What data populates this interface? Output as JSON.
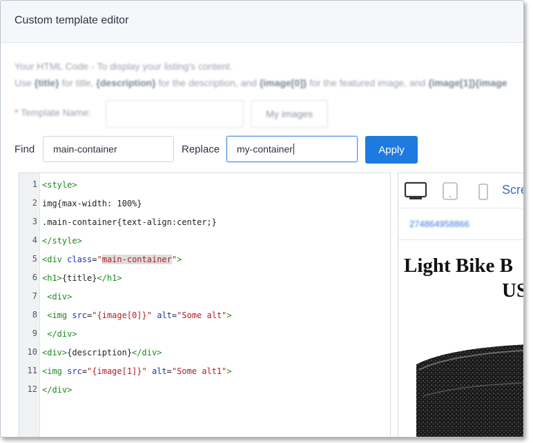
{
  "header": {
    "title": "Custom template editor"
  },
  "help": {
    "line1": "Your HTML Code - To display your listing's content.",
    "line2_parts": [
      "Use ",
      "{title}",
      " for title, ",
      "{description}",
      " for the description, and ",
      "{image[0]}",
      " for the featured image, and ",
      "{image[1]}{image"
    ]
  },
  "template_name": {
    "required_mark": "*",
    "label": "Template Name:",
    "value": ""
  },
  "my_images_button": "My images",
  "find": {
    "label": "Find",
    "value": "main-container"
  },
  "replace": {
    "label": "Replace",
    "value": "my-container"
  },
  "apply_button": "Apply",
  "editor": {
    "line_numbers": [
      "1",
      "2",
      "3",
      "4",
      "5",
      "6",
      "7",
      "8",
      "9",
      "10",
      "11",
      "12"
    ],
    "lines": [
      [
        {
          "t": "tag",
          "v": "<style>"
        }
      ],
      [
        {
          "t": "plain",
          "v": "img{max-width: 100%}"
        }
      ],
      [
        {
          "t": "plain",
          "v": ".main-container{text-align:center;}"
        }
      ],
      [
        {
          "t": "tag",
          "v": "</style>"
        }
      ],
      [
        {
          "t": "tag",
          "v": "<div "
        },
        {
          "t": "attr",
          "v": "class"
        },
        {
          "t": "plain",
          "v": "="
        },
        {
          "t": "str",
          "v": "\""
        },
        {
          "t": "str hl",
          "v": "main-container"
        },
        {
          "t": "str",
          "v": "\""
        },
        {
          "t": "tag",
          "v": ">"
        }
      ],
      [
        {
          "t": "tag",
          "v": "<h1>"
        },
        {
          "t": "plain",
          "v": "{title}"
        },
        {
          "t": "tag",
          "v": "</h1>"
        }
      ],
      [
        {
          "t": "tag",
          "v": " <div>"
        }
      ],
      [
        {
          "t": "tag",
          "v": " <img "
        },
        {
          "t": "attr",
          "v": "src"
        },
        {
          "t": "plain",
          "v": "="
        },
        {
          "t": "str",
          "v": "\"{image[0]}\""
        },
        {
          "t": "plain",
          "v": " "
        },
        {
          "t": "attr",
          "v": "alt"
        },
        {
          "t": "plain",
          "v": "="
        },
        {
          "t": "str",
          "v": "\"Some alt\""
        },
        {
          "t": "tag",
          "v": ">"
        }
      ],
      [
        {
          "t": "tag",
          "v": " </div>"
        }
      ],
      [
        {
          "t": "tag",
          "v": "<div>"
        },
        {
          "t": "plain",
          "v": "{description}"
        },
        {
          "t": "tag",
          "v": "</div>"
        }
      ],
      [
        {
          "t": "tag",
          "v": "<img "
        },
        {
          "t": "attr",
          "v": "src"
        },
        {
          "t": "plain",
          "v": "="
        },
        {
          "t": "str",
          "v": "\"{image[1]}\""
        },
        {
          "t": "plain",
          "v": " "
        },
        {
          "t": "attr",
          "v": "alt"
        },
        {
          "t": "plain",
          "v": "="
        },
        {
          "t": "str",
          "v": "\"Some alt1\""
        },
        {
          "t": "tag",
          "v": ">"
        }
      ],
      [
        {
          "t": "tag",
          "v": "</div>"
        }
      ]
    ]
  },
  "preview": {
    "toolbar": {
      "desktop_icon": "desktop-icon",
      "tablet_icon": "tablet-icon",
      "phone_icon": "phone-icon",
      "screen_label": "Scre"
    },
    "listing_id": "274864958866",
    "title_line1": "Light Bike B",
    "title_line2": "US",
    "image_icon": "bike-product-image"
  },
  "colors": {
    "accent": "#1f7ae0",
    "tag": "#1d8a1d",
    "attr": "#2233b8",
    "string": "#b01e1e"
  }
}
